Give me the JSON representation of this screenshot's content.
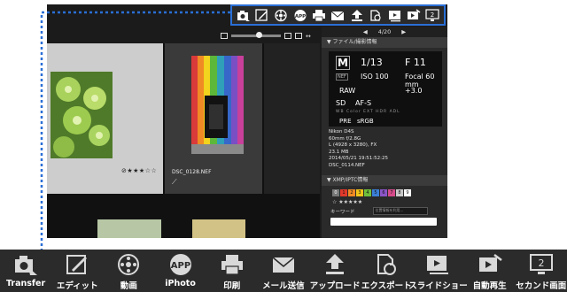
{
  "panel": {
    "nav_prev": "◀",
    "nav_counter": "4/20",
    "nav_next": "▶",
    "file_info_title": "▼ ファイル/撮影情報",
    "mode": "M",
    "shutter": "1/13",
    "aperture": "F 11",
    "nef_tag": "NEF",
    "iso": "ISO 100",
    "focal": "Focal 60 mm",
    "quality": "RAW",
    "exposure_comp": "+3.0",
    "card": "SD",
    "af_mode": "AF-S",
    "icon_labels": "WB Color EXT HDR ADL",
    "picture_control": "PRE",
    "color_space": "sRGB",
    "meta_lines": [
      "Nikon D4S",
      "60mm f/2.8G",
      "L (4928 x 3280), FX",
      "23.1 MB",
      "2014/05/21 19:51:52:25",
      "DSC_0114.NEF"
    ],
    "xmp_title": "▼ XMP/IPTC情報",
    "labels": [
      "0",
      "1",
      "2",
      "3",
      "4",
      "5",
      "6",
      "7",
      "8",
      "9"
    ],
    "label_colors": [
      "#777777",
      "#e0392b",
      "#f08a24",
      "#f0c419",
      "#6fbf3b",
      "#3b7fd6",
      "#8b55c8",
      "#d64b8a",
      "#c9c9c9",
      "#ffffff"
    ],
    "xmp_rating": "☆ ★★★★★",
    "keyword_label": "キーワード",
    "keyword_field": "位置情報を利用..."
  },
  "grid": {
    "left_rating": "⊘★★★☆☆",
    "selected_filename": "DSC_0128.NEF",
    "selected_edit": "⟋"
  },
  "top_toolbar": [
    {
      "name": "transfer"
    },
    {
      "name": "edit"
    },
    {
      "name": "movie"
    },
    {
      "name": "iphoto"
    },
    {
      "name": "print"
    },
    {
      "name": "mail"
    },
    {
      "name": "upload"
    },
    {
      "name": "export"
    },
    {
      "name": "slideshow"
    },
    {
      "name": "autoplay"
    },
    {
      "name": "second-screen"
    }
  ],
  "bottom_toolbar": [
    {
      "label": "Transfer"
    },
    {
      "label": "エディット"
    },
    {
      "label": "動画"
    },
    {
      "label": "iPhoto"
    },
    {
      "label": "印刷"
    },
    {
      "label": "メール送信"
    },
    {
      "label": "アップロード"
    },
    {
      "label": "エクスポート"
    },
    {
      "label": "スライドショー"
    },
    {
      "label": "自動再生"
    },
    {
      "label": "セカンド画面"
    }
  ],
  "icons": {
    "iphoto_text": "APP",
    "second_screen_text": "2"
  },
  "colors": {
    "toolbar_bg": "#2b2b2b",
    "highlight": "#2a6fd6",
    "connector": "#2a6fd6"
  }
}
